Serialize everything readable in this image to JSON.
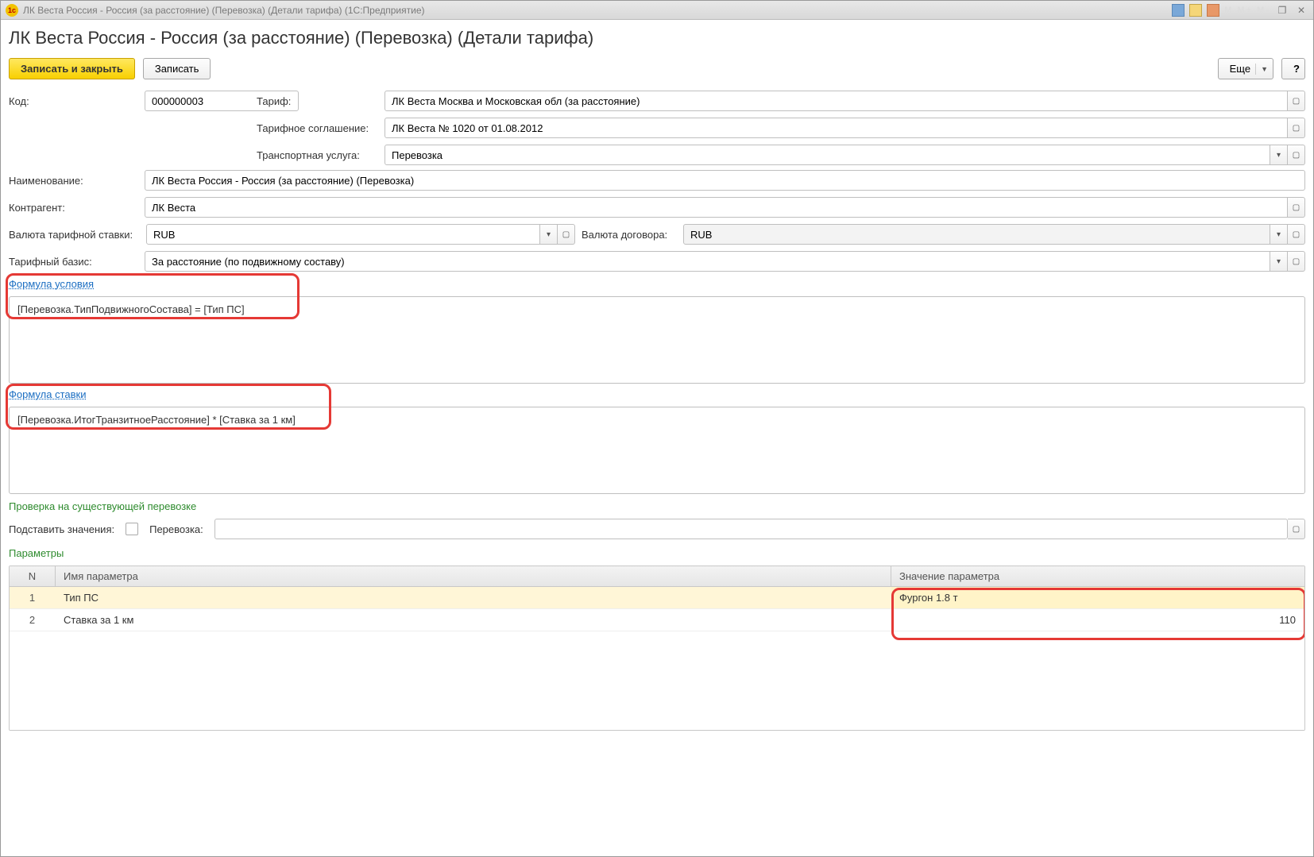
{
  "titlebar": {
    "text": "ЛК Веста Россия - Россия (за расстояние) (Перевозка) (Детали тарифа)  (1С:Предприятие)",
    "dim": "M M+ M-"
  },
  "page_title": "ЛК Веста Россия - Россия (за расстояние) (Перевозка) (Детали тарифа)",
  "toolbar": {
    "save_close": "Записать и закрыть",
    "save": "Записать",
    "more": "Еще",
    "help": "?"
  },
  "fields": {
    "code_label": "Код:",
    "code_value": "000000003",
    "tariff_label": "Тариф:",
    "tariff_value": "ЛК Веста Москва и Московская обл (за расстояние)",
    "agreement_label": "Тарифное соглашение:",
    "agreement_value": "ЛК Веста № 1020 от 01.08.2012",
    "service_label": "Транспортная услуга:",
    "service_value": "Перевозка",
    "name_label": "Наименование:",
    "name_value": "ЛК Веста Россия - Россия (за расстояние) (Перевозка)",
    "counterparty_label": "Контрагент:",
    "counterparty_value": "ЛК Веста",
    "rate_currency_label": "Валюта тарифной ставки:",
    "rate_currency_value": "RUB",
    "contract_currency_label": "Валюта договора:",
    "contract_currency_value": "RUB",
    "basis_label": "Тарифный базис:",
    "basis_value": "За расстояние (по подвижному составу)"
  },
  "formula_condition": {
    "link": "Формула условия",
    "text": "[Перевозка.ТипПодвижногоСостава] = [Тип ПС]"
  },
  "formula_rate": {
    "link": "Формула ставки",
    "text": "[Перевозка.ИтогТранзитноеРасстояние] * [Ставка за 1 км]"
  },
  "check_section": {
    "title": "Проверка на существующей перевозке",
    "substitute_label": "Подставить значения:",
    "perev_label": "Перевозка:"
  },
  "params": {
    "title": "Параметры",
    "col_n": "N",
    "col_name": "Имя параметра",
    "col_val": "Значение параметра",
    "rows": [
      {
        "n": "1",
        "name": "Тип ПС",
        "value": "Фургон 1.8 т",
        "num": false
      },
      {
        "n": "2",
        "name": "Ставка за 1 км",
        "value": "110",
        "num": true
      }
    ]
  }
}
